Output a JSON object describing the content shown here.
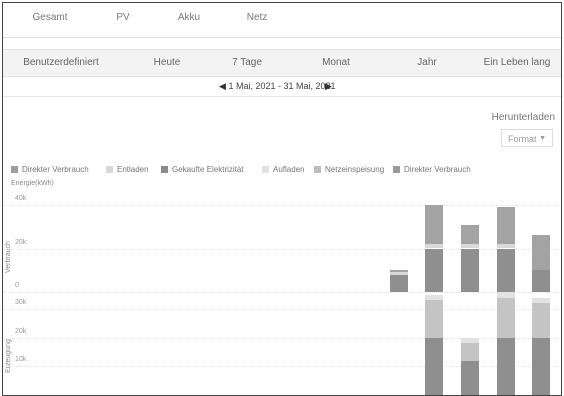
{
  "tabs": [
    {
      "label": "Gesamt",
      "active": true
    },
    {
      "label": "PV",
      "active": false
    },
    {
      "label": "Akku",
      "active": false
    },
    {
      "label": "Netz",
      "active": false
    }
  ],
  "filters": [
    {
      "label": "Benutzerdefiniert",
      "active": false
    },
    {
      "label": "Heute",
      "active": false
    },
    {
      "label": "7 Tage",
      "active": false
    },
    {
      "label": "Monat",
      "active": true
    },
    {
      "label": "Jahr",
      "active": false
    },
    {
      "label": "Ein Leben lang",
      "active": false
    }
  ],
  "date_nav": {
    "prev_icon": "triangle-left-icon",
    "next_icon": "triangle-right-icon",
    "range": "1 Mai, 2021 - 31 Mai, 2021"
  },
  "download": {
    "label": "Herunterladen",
    "format_label": "Format",
    "format_icon": "caret-down-icon"
  },
  "legend": [
    {
      "label": "Direkter Verbrauch",
      "color": "#9e9e9e"
    },
    {
      "label": "Entladen",
      "color": "#d8d8d8"
    },
    {
      "label": "Gekaufte Elektrizität",
      "color": "#8a8a8a"
    },
    {
      "label": "Aufladen",
      "color": "#e2e2e2"
    },
    {
      "label": "Netzeinspeisung",
      "color": "#bdbdbd"
    },
    {
      "label": "Direkter Verbrauch",
      "color": "#9a9a9a"
    }
  ],
  "chart_unit_label": "Energie(kWh)",
  "chart_data": [
    {
      "type": "bar",
      "panel_label": "Verbrauch",
      "stacked": true,
      "ylim": [
        0,
        40000
      ],
      "yticks": [
        "40k",
        "20k",
        "0"
      ],
      "series": [
        {
          "name": "Direkter Verbrauch",
          "color": "#8f8f8f",
          "values": [
            0,
            0,
            0,
            0,
            0,
            0,
            0,
            0,
            0,
            0,
            8000,
            20000,
            20000,
            20000,
            10000
          ]
        },
        {
          "name": "Entladen",
          "color": "#d8d8d8",
          "values": [
            0,
            0,
            0,
            0,
            0,
            0,
            0,
            0,
            0,
            0,
            1000,
            2000,
            2000,
            2000,
            0
          ]
        },
        {
          "name": "Gekaufte Elektrizität",
          "color": "#a3a3a3",
          "values": [
            0,
            0,
            0,
            0,
            0,
            0,
            0,
            0,
            0,
            0,
            1000,
            18000,
            9000,
            17000,
            16000
          ]
        }
      ]
    },
    {
      "type": "bar",
      "panel_label": "Erzeugung",
      "stacked": true,
      "ylim": [
        0,
        30000
      ],
      "yticks": [
        "30k",
        "20k",
        "10k"
      ],
      "series": [
        {
          "name": "Direkter Verbrauch",
          "color": "#8f8f8f",
          "values": [
            0,
            0,
            0,
            0,
            0,
            0,
            0,
            0,
            0,
            0,
            0,
            20000,
            12000,
            20000,
            20000
          ]
        },
        {
          "name": "Netzeinspeisung",
          "color": "#c4c4c4",
          "values": [
            0,
            0,
            0,
            0,
            0,
            0,
            0,
            0,
            0,
            0,
            0,
            13000,
            6000,
            14000,
            12000
          ]
        },
        {
          "name": "Aufladen",
          "color": "#e2e2e2",
          "values": [
            0,
            0,
            0,
            0,
            0,
            0,
            0,
            0,
            0,
            0,
            0,
            2000,
            2000,
            2000,
            2000
          ]
        }
      ]
    }
  ]
}
